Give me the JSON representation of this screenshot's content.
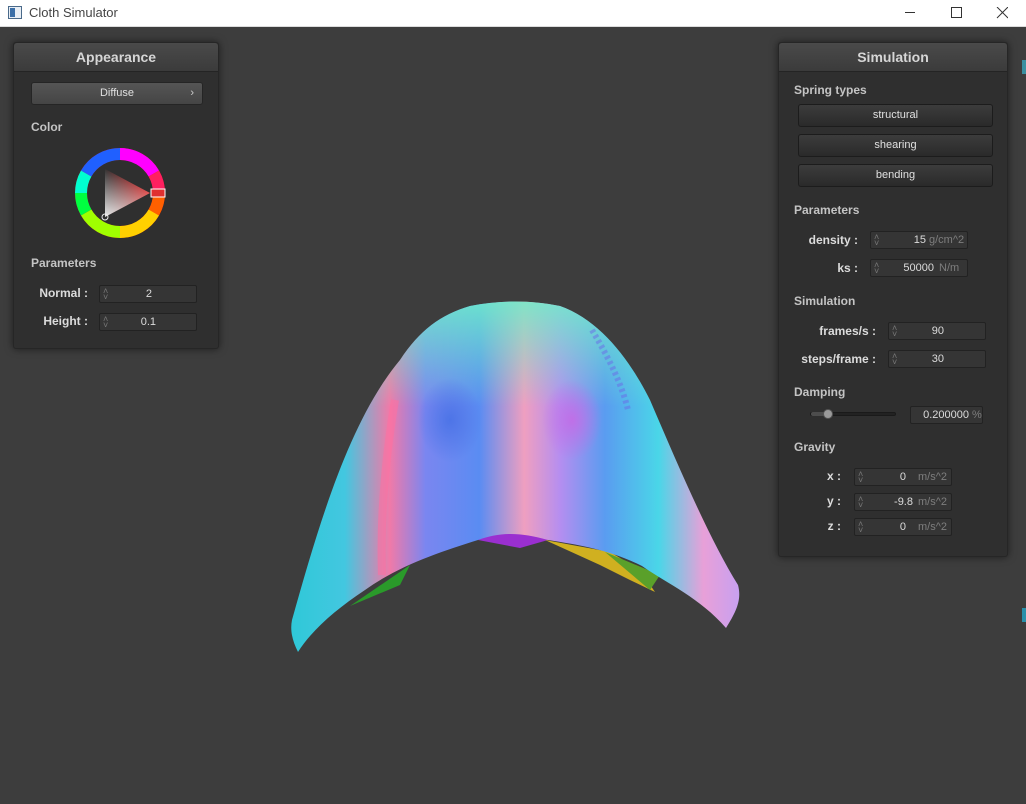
{
  "window": {
    "title": "Cloth Simulator"
  },
  "appearance": {
    "header": "Appearance",
    "shader_select": "Diffuse",
    "color_label": "Color",
    "params_label": "Parameters",
    "normal_label": "Normal :",
    "normal_value": "2",
    "height_label": "Height :",
    "height_value": "0.1"
  },
  "simulation": {
    "header": "Simulation",
    "spring_types_label": "Spring types",
    "structural_label": "structural",
    "shearing_label": "shearing",
    "bending_label": "bending",
    "params_label": "Parameters",
    "density_label": "density :",
    "density_value": "15",
    "density_unit": "g/cm^2",
    "ks_label": "ks :",
    "ks_value": "50000",
    "ks_unit": "N/m",
    "sim_label": "Simulation",
    "fps_label": "frames/s :",
    "fps_value": "90",
    "steps_label": "steps/frame :",
    "steps_value": "30",
    "damping_label": "Damping",
    "damping_value": "0.200000",
    "damping_unit": "%",
    "damping_slider_fraction": 0.2,
    "gravity_label": "Gravity",
    "gx_label": "x :",
    "gx_value": "0",
    "gy_label": "y :",
    "gy_value": "-9.8",
    "gz_label": "z :",
    "gz_value": "0",
    "gravity_unit": "m/s^2"
  },
  "colors": {
    "background": "#3d3d3d",
    "panel": "#2f2f2f",
    "selected_color": "#d52a2a"
  }
}
